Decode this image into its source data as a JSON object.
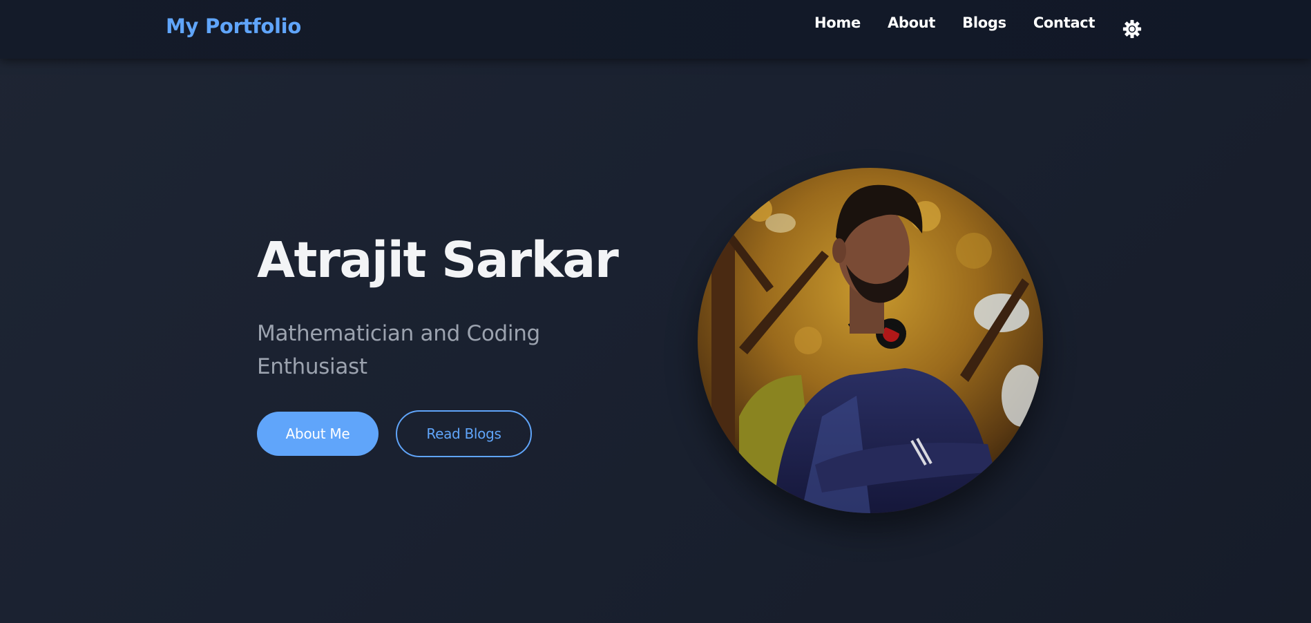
{
  "navbar": {
    "brand": "My Portfolio",
    "links": [
      {
        "label": "Home"
      },
      {
        "label": "About"
      },
      {
        "label": "Blogs"
      },
      {
        "label": "Contact"
      }
    ],
    "theme_toggle_icon": "gear-icon"
  },
  "hero": {
    "name": "Atrajit Sarkar",
    "subtitle": "Mathematician and Coding Enthusiast",
    "buttons": {
      "primary_label": "About Me",
      "secondary_label": "Read Blogs"
    },
    "portrait_icon": "portrait-photo"
  },
  "colors": {
    "accent": "#60a5fa",
    "background": "#1a2130",
    "navbar": "#111827",
    "heading": "#f3f4f6",
    "muted": "#9ca3af"
  }
}
